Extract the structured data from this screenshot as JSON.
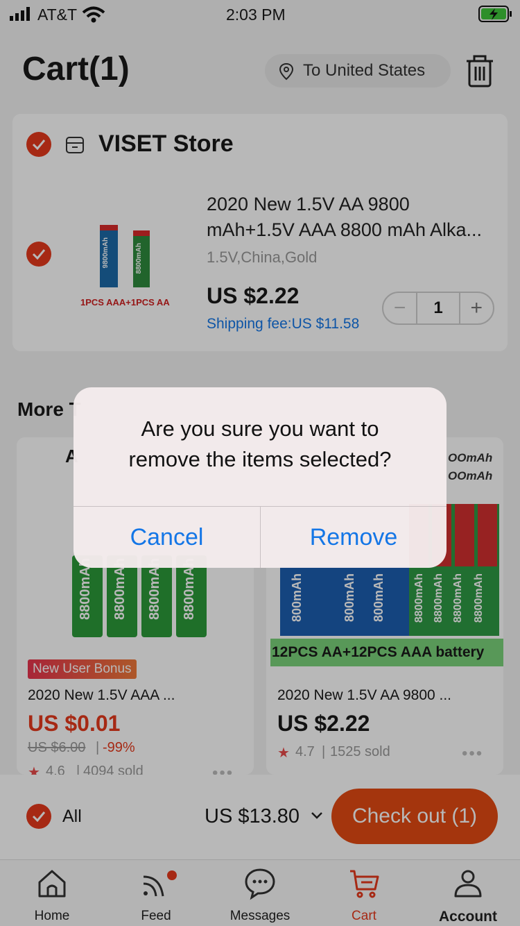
{
  "status_bar": {
    "carrier": "AT&T",
    "time": "2:03 PM"
  },
  "header": {
    "title": "Cart(1)",
    "location_label": "To United States"
  },
  "store": {
    "name": "VISET Store",
    "item": {
      "title_line1": "2020 New 1.5V AA 9800",
      "title_line2": "mAh+1.5V AAA 8800 mAh Alka...",
      "variant": "1.5V,China,Gold",
      "price": "US $2.22",
      "shipping": "Shipping fee:US $11.58",
      "quantity": "1",
      "image_label": "1PCS AAA+1PCS AA",
      "battery_big_text": "9800mAh",
      "battery_small_text": "8800mAh"
    }
  },
  "more_section": {
    "heading": "More T"
  },
  "recommendations": [
    {
      "badge": "New User Bonus",
      "title": "2020 New 1.5V AAA ...",
      "price": "US $0.01",
      "original_price": "US $6.00",
      "discount": "-99%",
      "rating": "4.6",
      "sold": "4094 sold",
      "image_text": "8800mAh",
      "image_top_letter": "A"
    },
    {
      "title": "2020 New 1.5V AA 9800 ...",
      "price": "US $2.22",
      "rating": "4.7",
      "sold": "1525 sold",
      "image_banner": "12PCS AA+12PCS AAA battery",
      "image_top_text_1": "OOmAh",
      "image_top_text_2": "OOmAh",
      "image_text": "800mAh",
      "image_text_b": "8800mAh"
    }
  ],
  "footer": {
    "all_label": "All",
    "total": "US $13.80",
    "checkout_label": "Check out (1)"
  },
  "tabs": [
    {
      "label": "Home",
      "icon": "home-icon"
    },
    {
      "label": "Feed",
      "icon": "feed-icon"
    },
    {
      "label": "Messages",
      "icon": "messages-icon"
    },
    {
      "label": "Cart",
      "icon": "cart-icon"
    },
    {
      "label": "Account",
      "icon": "account-icon"
    }
  ],
  "dialog": {
    "line1": "Are you sure you want to",
    "line2": "remove the items selected?",
    "cancel_label": "Cancel",
    "remove_label": "Remove"
  },
  "colors": {
    "accent": "#e63a1d",
    "link": "#1476e6",
    "checkout": "#e34a12"
  }
}
